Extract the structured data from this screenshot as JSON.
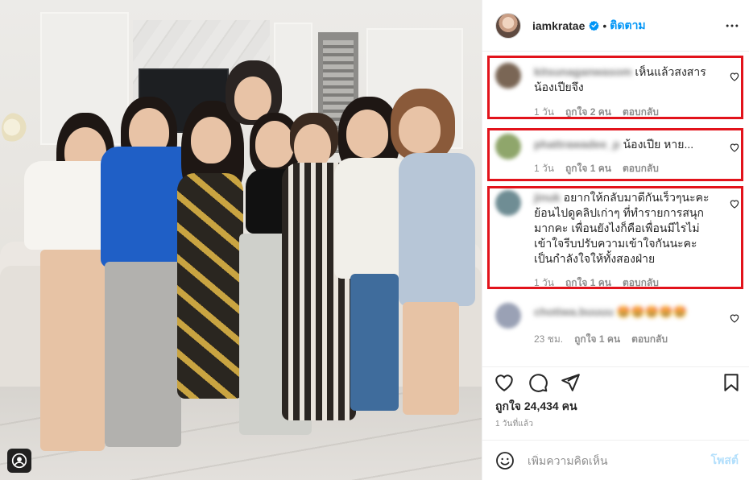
{
  "header": {
    "username": "iamkratae",
    "separator": "•",
    "follow_label": "ติดตาม",
    "more_icon": "more-horizontal-icon",
    "verified_icon": "verified-badge-icon"
  },
  "comments": [
    {
      "username": "kitsunaganwasom",
      "text": "เห็นแล้วสงสาร น้องเปียจึง",
      "time": "1 วัน",
      "likes": "ถูกใจ 2 คน",
      "reply": "ตอบกลับ",
      "avatar_color": "#7a6655"
    },
    {
      "username": "phattrawadee_p",
      "text": "น้องเปีย หาย...",
      "time": "1 วัน",
      "likes": "ถูกใจ 1 คน",
      "reply": "ตอบกลับ",
      "avatar_color": "#8fa66b"
    },
    {
      "username": "jinuk",
      "text": "อยากให้กลับมาดีกันเร็วๆนะคะ ย้อนไปดูคลิปเก่าๆ ที่ทำรายการสนุกมากคะ เพื่อนยังไงก็คือเพื่อนมีไรไม่เข้าใจรีบปรับความเข้าใจกันนะคะ เป็นกำลังใจให้ทั้งสองฝ่าย",
      "time": "1 วัน",
      "likes": "ถูกใจ 1 คน",
      "reply": "ตอบกลับ",
      "avatar_color": "#6f8d94"
    },
    {
      "username": "chotiwa.buuuu",
      "text": "🤩🤩🤩🤩🤩",
      "time": "23 ชม.",
      "likes": "ถูกใจ 1 คน",
      "reply": "ตอบกลับ",
      "avatar_color": "#9aa1b5"
    }
  ],
  "actions": {
    "like_icon": "heart-icon",
    "comment_icon": "comment-icon",
    "share_icon": "send-icon",
    "save_icon": "bookmark-icon"
  },
  "likes_label": "ถูกใจ 24,434 คน",
  "post_time": "1 วันที่แล้ว",
  "add_comment": {
    "placeholder": "เพิ่มความคิดเห็น",
    "post_label": "โพสต์",
    "emoji_icon": "smiley-icon"
  },
  "colors": {
    "accent": "#0095f6",
    "highlight_box": "#e2131b",
    "post_disabled": "#b2dffc"
  }
}
